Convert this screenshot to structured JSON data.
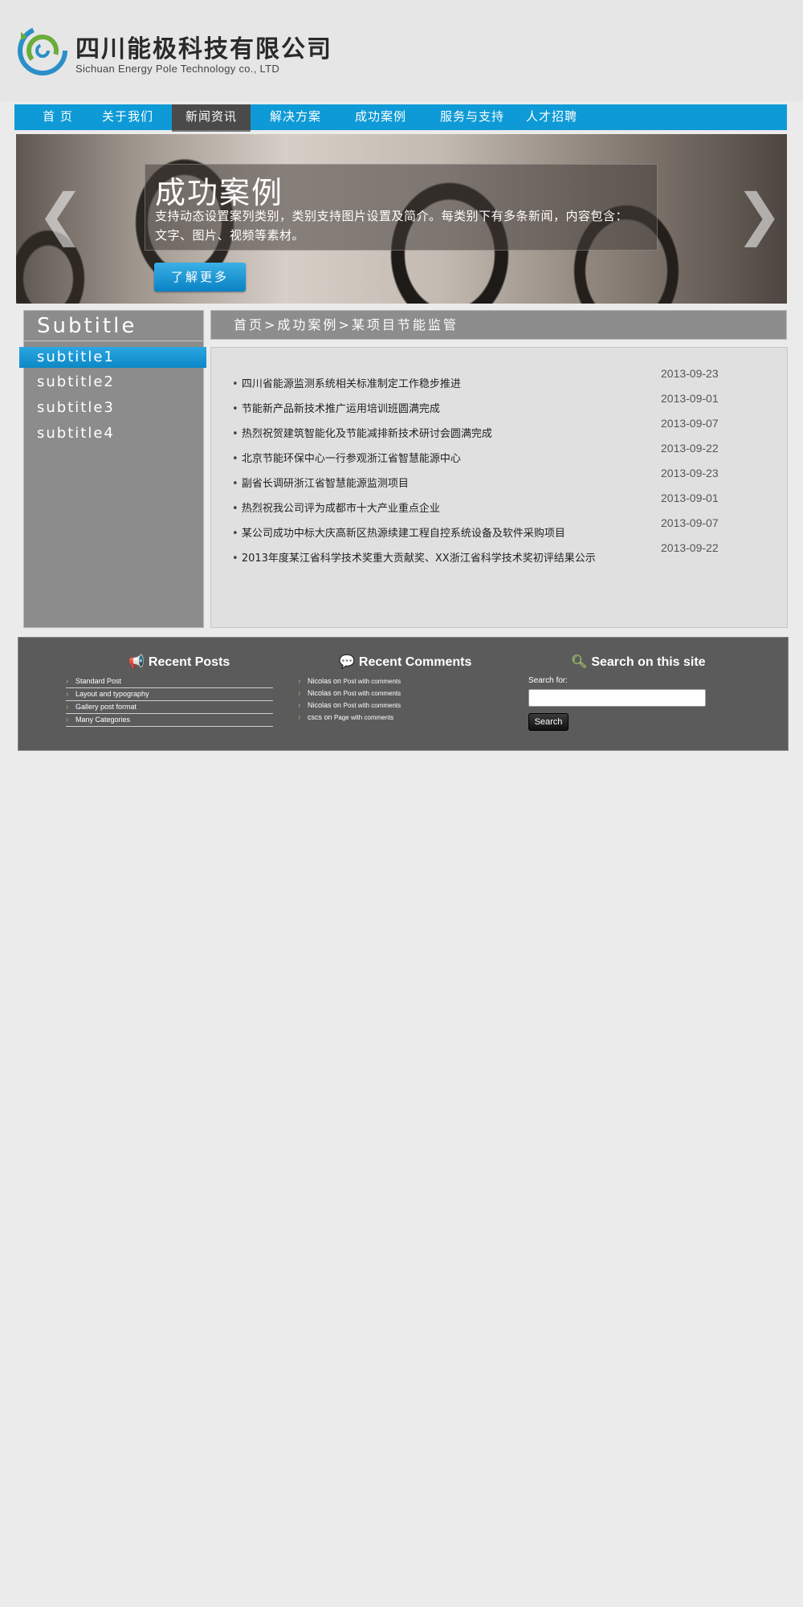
{
  "logo": {
    "name_cn": "四川能极科技有限公司",
    "name_en": "Sichuan Energy Pole Technology co., LTD"
  },
  "nav": {
    "items": [
      "首 页",
      "关于我们",
      "新闻资讯",
      "解决方案",
      "成功案例",
      "服务与支持",
      "人才招聘"
    ],
    "active": "新闻资讯"
  },
  "banner": {
    "title": "成功案例",
    "description": "支持动态设置案列类别，类别支持图片设置及简介。每类别下有多条新闻，内容包含：文字、图片、视频等素材。",
    "button_label": "了解更多",
    "prev_icon": "chevron-left-icon",
    "next_icon": "chevron-right-icon"
  },
  "sidebar": {
    "title": "Subtitle",
    "items": [
      "subtitle1",
      "subtitle2",
      "subtitle3",
      "subtitle4"
    ],
    "active_index": 0
  },
  "breadcrumb": {
    "text": "首页>成功案例>某项目节能监管"
  },
  "news": {
    "items": [
      {
        "title": "四川省能源监测系统相关标准制定工作稳步推进",
        "date": "2013-09-23"
      },
      {
        "title": "节能新产品新技术推广运用培训班圆满完成",
        "date": "2013-09-01"
      },
      {
        "title": "热烈祝贺建筑智能化及节能减排新技术研讨会圆满完成",
        "date": "2013-09-07"
      },
      {
        "title": "北京节能环保中心一行参观浙江省智慧能源中心",
        "date": "2013-09-22"
      },
      {
        "title": "副省长调研浙江省智慧能源监测项目",
        "date": "2013-09-23"
      },
      {
        "title": "热烈祝我公司评为成都市十大产业重点企业",
        "date": "2013-09-01"
      },
      {
        "title": "某公司成功中标大庆高新区热源续建工程自控系统设备及软件采购项目",
        "date": "2013-09-07"
      },
      {
        "title": "2013年度某江省科学技术奖重大贡献奖、XX浙江省科学技术奖初评结果公示",
        "date": "2013-09-22"
      }
    ]
  },
  "widgets": {
    "recent_posts": {
      "title": "Recent Posts",
      "icon": "megaphone-icon",
      "items": [
        "Standard Post",
        "Layout and typography",
        "Gallery post format",
        "Many Categories"
      ]
    },
    "recent_comments": {
      "title": "Recent Comments",
      "icon": "speech-bubbles-icon",
      "items": [
        {
          "author": "Nicolas",
          "on": "on",
          "post": "Post with comments"
        },
        {
          "author": "Nicolas",
          "on": "on",
          "post": "Post with comments"
        },
        {
          "author": "Nicolas",
          "on": "on",
          "post": "Post with comments"
        },
        {
          "author": "cscs",
          "on": "on",
          "post": "Page with comments"
        }
      ]
    },
    "search": {
      "title": "Search on this site",
      "icon": "magnifier-icon",
      "label": "Search for:",
      "placeholder": "",
      "button_label": "Search"
    }
  },
  "colors": {
    "nav_blue": "#0e9ad6",
    "active_nav": "#4a4a4a",
    "sidebar_gray": "#8c8c8c",
    "widget_bg": "#5b5b5b",
    "accent_green": "#9fbf6a"
  }
}
